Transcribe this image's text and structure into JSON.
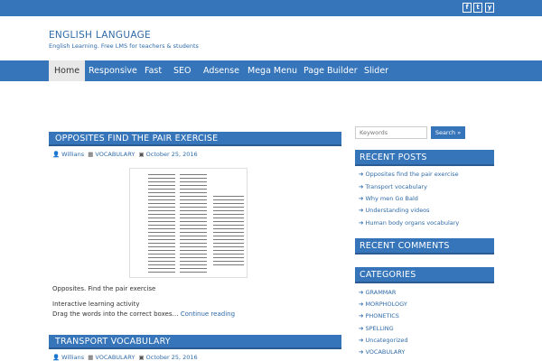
{
  "site": {
    "title": "ENGLISH LANGUAGE",
    "tagline": "English Learning. Free LMS for teachers & students"
  },
  "social": {
    "facebook": "f",
    "twitter": "t",
    "youtube": "y"
  },
  "nav": [
    "Home",
    "Responsive",
    "Fast",
    "SEO",
    "Adsense",
    "Mega Menu",
    "Page Builder",
    "Slider"
  ],
  "posts": [
    {
      "title": "OPPOSITES FIND THE PAIR EXERCISE",
      "author": "Willians",
      "category": "VOCABULARY",
      "date": "October 25, 2016",
      "excerpt_line1": "Opposites. Find the pair exercise",
      "excerpt_line2": "Interactive learning activity",
      "excerpt_line3": "Drag the words into the correct boxes…",
      "more": "Continue reading"
    },
    {
      "title": "TRANSPORT VOCABULARY",
      "author": "Willians",
      "category": "VOCABULARY",
      "date": "October 25, 2016"
    }
  ],
  "search": {
    "placeholder": "Keywords",
    "button": "Search »"
  },
  "sidebar": {
    "recent_posts_title": "RECENT POSTS",
    "recent_posts": [
      "Opposites find the pair exercise",
      "Transport vocabulary",
      "Why men Go Bald",
      "Understanding videos",
      "Human body organs vocabulary"
    ],
    "recent_comments_title": "RECENT COMMENTS",
    "categories_title": "CATEGORIES",
    "categories": [
      "GRAMMAR",
      "MORPHOLOGY",
      "PHONETICS",
      "SPELLING",
      "Uncategorized",
      "VOCABULARY"
    ]
  },
  "colors": {
    "brand": "#3675ba",
    "brand_dark": "#2a5c93",
    "link": "#2f6ba9"
  }
}
